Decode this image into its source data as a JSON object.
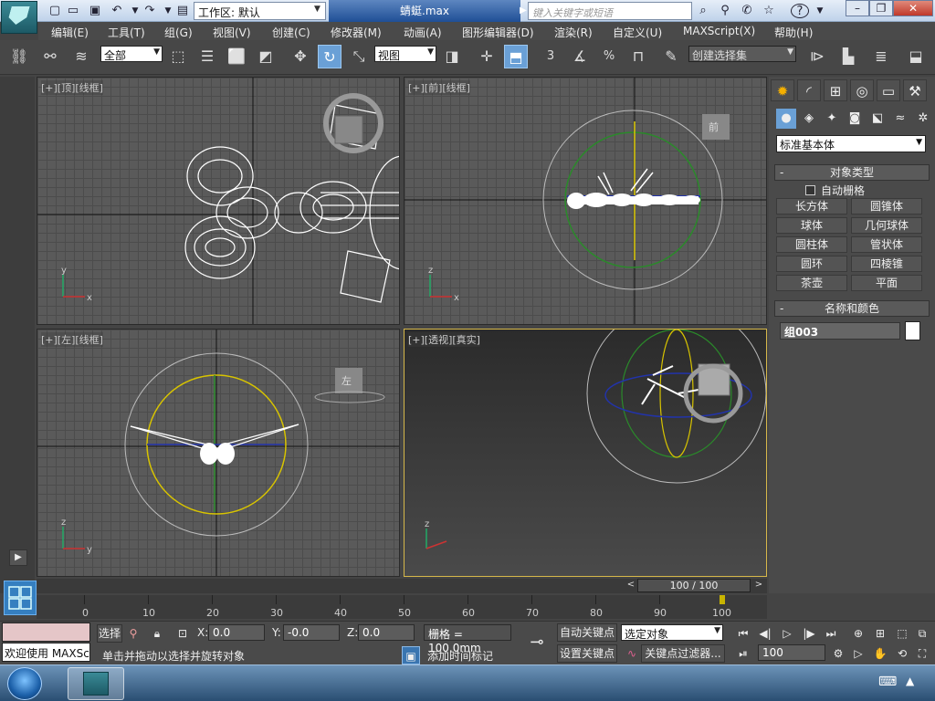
{
  "titlebar": {
    "workspace_label": "工作区: 默认",
    "filename": "蜻蜓.max",
    "search_placeholder": "键入关键字或短语"
  },
  "menu": [
    "编辑(E)",
    "工具(T)",
    "组(G)",
    "视图(V)",
    "创建(C)",
    "修改器(M)",
    "动画(A)",
    "图形编辑器(D)",
    "渲染(R)",
    "自定义(U)",
    "MAXScript(X)",
    "帮助(H)"
  ],
  "toolbar": {
    "selection_filter": "全部",
    "ref_coord": "视图",
    "snap_3": "3",
    "snap_pct": "%",
    "named_selection": "创建选择集"
  },
  "viewports": {
    "top": "[+][顶][线框]",
    "front": "[+][前][线框]",
    "left": "[+][左][线框]",
    "persp": "[+][透视][真实]"
  },
  "view_cubes": {
    "front": "前",
    "left": "左"
  },
  "axis_labels": {
    "x": "x",
    "y": "y",
    "z": "z"
  },
  "command_panel": {
    "primitive_type": "标准基本体",
    "object_type_title": "对象类型",
    "autogrid_label": "自动栅格",
    "objects": [
      "长方体",
      "圆锥体",
      "球体",
      "几何球体",
      "圆柱体",
      "管状体",
      "圆环",
      "四棱锥",
      "茶壶",
      "平面"
    ],
    "name_color_title": "名称和颜色",
    "object_name": "组003",
    "object_color": "#ffffff"
  },
  "timeline": {
    "slider_text": "100 / 100",
    "ticks": [
      "0",
      "10",
      "20",
      "30",
      "40",
      "50",
      "60",
      "70",
      "80",
      "90",
      "100"
    ]
  },
  "status": {
    "maxscript_text": "欢迎使用 MAXScr",
    "selection_label": "选择",
    "x_label": "X:",
    "x_value": "0.0",
    "y_label": "Y:",
    "y_value": "-0.0",
    "z_label": "Z:",
    "z_value": "0.0",
    "grid_text": "栅格 = 100.0mm",
    "prompt": "单击并拖动以选择并旋转对象",
    "add_time_tag": "添加时间标记",
    "auto_key": "自动关键点",
    "set_key": "设置关键点",
    "key_mode": "选定对象",
    "key_filters": "关键点过滤器...",
    "frame": "100"
  }
}
